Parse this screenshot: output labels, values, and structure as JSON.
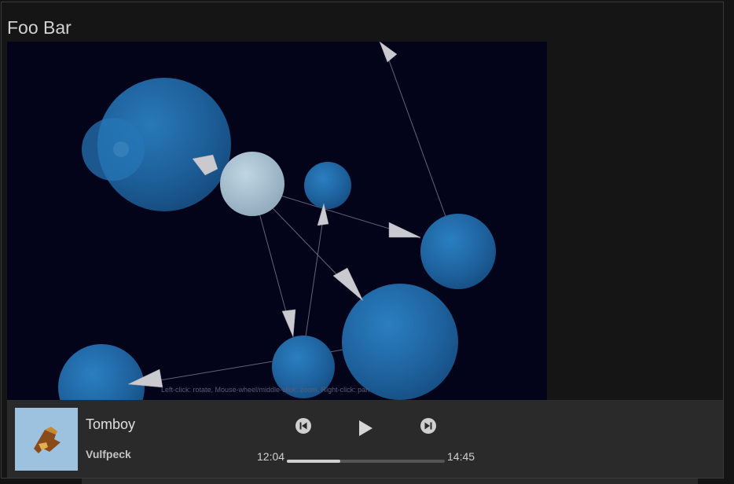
{
  "page": {
    "title": "Foo Bar"
  },
  "graph_view": {
    "controls_hint": "Left-click: rotate, Mouse-wheel/middle-click: zoom, Right-click: pan",
    "background_color": "#03031a",
    "node_color": "#1f6aa8",
    "selected_node_color": "#a6c2d4",
    "link_color": "#8a8f9c"
  },
  "player": {
    "album_art_color": "#9cc2e0",
    "track_title": "Tomboy",
    "artist": "Vulfpeck",
    "current_time": "12:04",
    "total_time": "14:45",
    "progress_fraction": 0.34,
    "controls": {
      "previous_icon": "skip-previous-icon",
      "play_icon": "play-icon",
      "next_icon": "skip-next-icon"
    }
  }
}
